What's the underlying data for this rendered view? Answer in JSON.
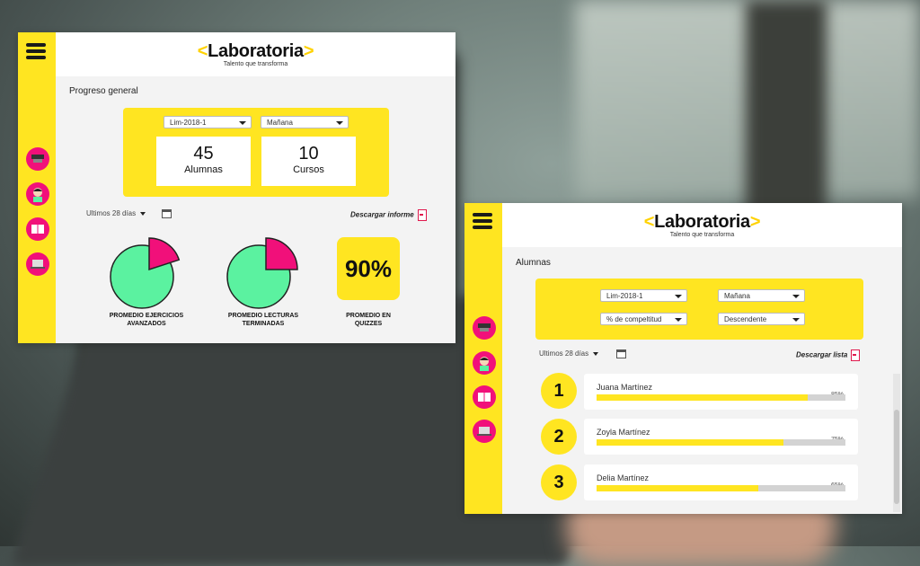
{
  "brand": {
    "name": "Laboratoria",
    "tagline": "Talento que transforma",
    "colors": {
      "yellow": "#ffe521",
      "magenta": "#f1107a",
      "green": "#5bf2a0"
    }
  },
  "dashboard": {
    "title": "Progreso general",
    "filters": {
      "cohort": "Lim-2018-1",
      "shift": "Mañana"
    },
    "stats": [
      {
        "value": "45",
        "label": "Alumnas"
      },
      {
        "value": "10",
        "label": "Cursos"
      }
    ],
    "date_range": "Ultimos 28 días",
    "download_label": "Descargar informe",
    "metrics": [
      {
        "label_line1": "PROMEDIO EJERCICIOS",
        "label_line2": "AVANZADOS",
        "percent": 20
      },
      {
        "label_line1": "PROMEDIO LECTURAS",
        "label_line2": "TERMINADAS",
        "percent": 25
      },
      {
        "label_line1": "PROMEDIO EN",
        "label_line2": "QUIZZES",
        "value": "90%"
      }
    ]
  },
  "students": {
    "title": "Alumnas",
    "filters": {
      "cohort": "Lim-2018-1",
      "shift": "Mañana",
      "sort_by": "% de compeltitud",
      "order": "Descendente"
    },
    "date_range": "Ultimos 28 días",
    "download_label": "Descargar lista",
    "ranking": [
      {
        "rank": "1",
        "name": "Juana Martínez",
        "percent_label": "85%",
        "percent": 85
      },
      {
        "rank": "2",
        "name": "Zoyla Martínez",
        "percent_label": "75%",
        "percent": 75
      },
      {
        "rank": "3",
        "name": "Delia Martínez",
        "percent_label": "65%",
        "percent": 65
      }
    ]
  },
  "nav_icons": [
    "cohort-cap-icon",
    "student-avatar-icon",
    "course-book-icon",
    "computer-icon"
  ]
}
